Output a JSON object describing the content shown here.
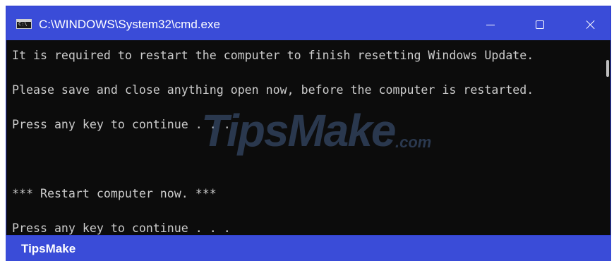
{
  "window": {
    "title": "C:\\WINDOWS\\System32\\cmd.exe",
    "icon": "cmd-app-icon",
    "controls": {
      "minimize_icon": "minimize-icon",
      "maximize_icon": "maximize-icon",
      "close_icon": "close-icon"
    },
    "accent_color": "#3a4cd8",
    "background_color": "#0c0c0c",
    "text_color": "#cccccc"
  },
  "console": {
    "lines": [
      "It is required to restart the computer to finish resetting Windows Update.",
      "Please save and close anything open now, before the computer is restarted.",
      "Press any key to continue . . .",
      "*** Restart computer now. ***",
      "Press any key to continue . . ."
    ]
  },
  "watermark": {
    "main": "TipsMake",
    "suffix": ".com"
  },
  "footer": {
    "label": "TipsMake"
  }
}
